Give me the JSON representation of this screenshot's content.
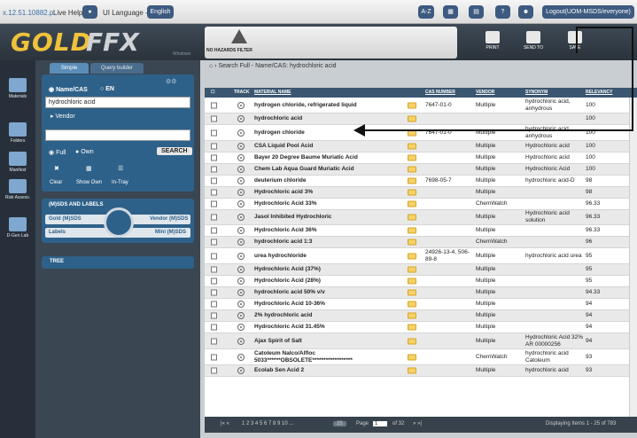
{
  "topbar": {
    "ip": "x.12.51.10882.p",
    "live_help": "Live Help",
    "ui_language": "UI Language -",
    "language": "English",
    "az": "A-Z",
    "logout": "Logout(UOM-MSDS/everyone)"
  },
  "header": {
    "logo_gold": "GOLD",
    "logo_ffx": "FFX",
    "logo_sub": "Windows",
    "hazards": "NO HAZARDS FILTER",
    "print": "PRINT",
    "send_to": "SEND TO",
    "save": "SAVE"
  },
  "sidebar": {
    "items": [
      {
        "label": "Materials"
      },
      {
        "label": "Folders"
      },
      {
        "label": "Manifest"
      },
      {
        "label": "Risk Assess."
      },
      {
        "label": "D-Gen Lab"
      }
    ]
  },
  "left": {
    "tab_simple": "Simple",
    "tab_query": "Query builder",
    "name_cas": "Name/CAS",
    "en": "EN",
    "search_value": "hydrochloric acid",
    "vendor": "Vendor",
    "full": "Full",
    "own": "Own",
    "search": "SEARCH",
    "clear": "Clear",
    "show_own": "Show Own",
    "in_tray": "In-Tray",
    "msds_labels": "(M)SDS AND LABELS",
    "gold_msds": "Gold (M)SDS",
    "vendor_msds": "Vendor (M)SDS",
    "labels": "Labels",
    "mini_msds": "Mini (M)SDS",
    "tree": "TREE"
  },
  "content": {
    "breadcrumb": "Search Full - Name/CAS: hydrochloric acid"
  },
  "grid": {
    "headers": {
      "track": "TRACK",
      "name": "MATERIAL NAME",
      "cas": "CAS NUMBER",
      "vendor": "VENDOR",
      "synonym": "SYNONYM",
      "relevancy": "RELEVANCY"
    },
    "rows": [
      {
        "name": "hydrogen chloride, refrigerated liquid",
        "cas": "7647-01-0",
        "vendor": "Multiple",
        "synonym": "hydrochloric acid, anhydrous",
        "rel": "100"
      },
      {
        "name": "hydrochloric acid",
        "cas": "",
        "vendor": "",
        "synonym": "",
        "rel": "100"
      },
      {
        "name": "hydrogen chloride",
        "cas": "7647-01-0",
        "vendor": "Multiple",
        "synonym": "hydrochloric acid, anhydrous",
        "rel": "100"
      },
      {
        "name": "CSA Liquid Pool Acid",
        "cas": "",
        "vendor": "Multiple",
        "synonym": "Hydrochloric acid",
        "rel": "100"
      },
      {
        "name": "Bayer 20 Degree Baume Muriatic Acid",
        "cas": "",
        "vendor": "Multiple",
        "synonym": "Hydrochloric acid",
        "rel": "100"
      },
      {
        "name": "Chem Lab Aqua Guard Muriatic Acid",
        "cas": "",
        "vendor": "Multiple",
        "synonym": "Hydrochloric Acid",
        "rel": "100"
      },
      {
        "name": "deuterium chloride",
        "cas": "7698-05-7",
        "vendor": "Multiple",
        "synonym": "hydrochloric acid-D",
        "rel": "98"
      },
      {
        "name": "Hydrochloric acid 3%",
        "cas": "",
        "vendor": "Multiple",
        "synonym": "",
        "rel": "98"
      },
      {
        "name": "Hydrochloric Acid 33%",
        "cas": "",
        "vendor": "ChemWatch",
        "synonym": "",
        "rel": "96.33"
      },
      {
        "name": "Jasol Inhibited Hydrochloric",
        "cas": "",
        "vendor": "Multiple",
        "synonym": "Hydrochloric acid solution",
        "rel": "96.33"
      },
      {
        "name": "Hydrochloric Acid 36%",
        "cas": "",
        "vendor": "Multiple",
        "synonym": "",
        "rel": "96.33"
      },
      {
        "name": "hydrochloric acid 1:3",
        "cas": "",
        "vendor": "ChemWatch",
        "synonym": "",
        "rel": "96"
      },
      {
        "name": "urea hydrochloride",
        "cas": "24926-13-4, 506-89-8",
        "vendor": "Multiple",
        "synonym": "hydrochloric acid urea",
        "rel": "95"
      },
      {
        "name": "Hydrochloric Acid (37%)",
        "cas": "",
        "vendor": "Multiple",
        "synonym": "",
        "rel": "95"
      },
      {
        "name": "Hydrochloric Acid (28%)",
        "cas": "",
        "vendor": "Multiple",
        "synonym": "",
        "rel": "95"
      },
      {
        "name": "hydrochloric acid 50% v/v",
        "cas": "",
        "vendor": "Multiple",
        "synonym": "",
        "rel": "94.33"
      },
      {
        "name": "Hydrochloric Acid 10-36%",
        "cas": "",
        "vendor": "Multiple",
        "synonym": "",
        "rel": "94"
      },
      {
        "name": "2% hydrochloric acid",
        "cas": "",
        "vendor": "Multiple",
        "synonym": "",
        "rel": "94"
      },
      {
        "name": "Hydrochloric Acid 31.45%",
        "cas": "",
        "vendor": "Multiple",
        "synonym": "",
        "rel": "94"
      },
      {
        "name": "Ajax Spirit of Salt",
        "cas": "",
        "vendor": "Multiple",
        "synonym": "Hydrochloric Acid 32% AR 00000256",
        "rel": "94"
      },
      {
        "name": "Catoleum Nalco/Alfloc 5033******OBSOLETE******************",
        "cas": "",
        "vendor": "ChemWatch",
        "synonym": "hydrochloric acid Catoleum",
        "rel": "93"
      },
      {
        "name": "Ecolab Sen Acid 2",
        "cas": "",
        "vendor": "Multiple",
        "synonym": "hydrochloric acid",
        "rel": "93"
      }
    ]
  },
  "footer": {
    "pages": "1 2 3 4 5 6 7 8 9 10 ...",
    "page_size": "25",
    "page_label": "Page",
    "page_value": "1",
    "of_pages": "of 32",
    "items": "Displaying Items 1 - 25 of 783"
  }
}
